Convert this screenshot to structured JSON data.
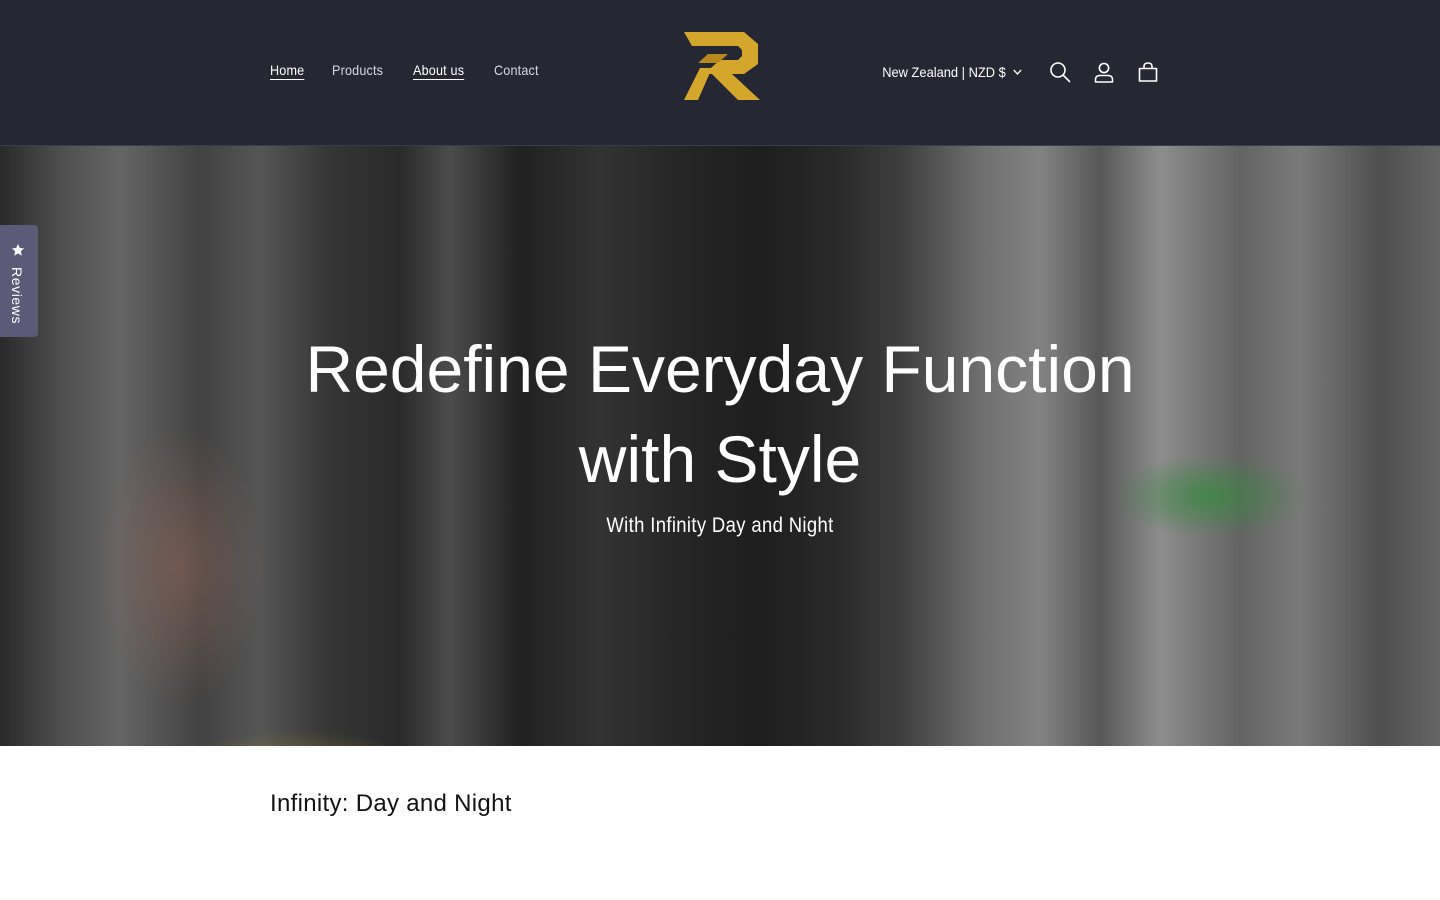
{
  "header": {
    "nav": [
      "Home",
      "Products",
      "About us",
      "Contact"
    ],
    "region_selector": "New Zealand | NZD $",
    "brand_colors": {
      "background": "#252733",
      "logo_gold": "#d4a72c"
    },
    "icons": [
      "search-icon",
      "account-icon",
      "cart-icon"
    ]
  },
  "reviews_tab": {
    "label": "Reviews",
    "icon": "star-icon"
  },
  "hero": {
    "title_line1": "Redefine Everyday Function",
    "title_line2": "with Style",
    "subtitle": "With Infinity Day and Night"
  },
  "section": {
    "title": "Infinity: Day and Night"
  }
}
